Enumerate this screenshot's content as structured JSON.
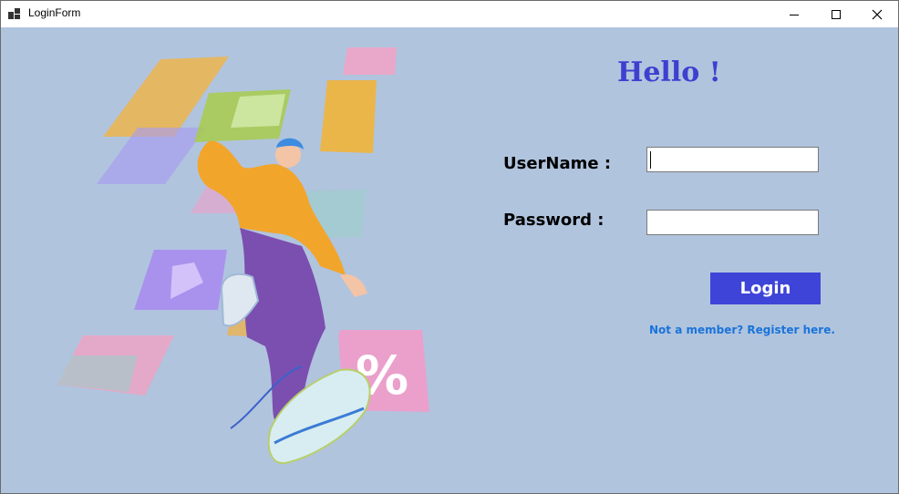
{
  "window": {
    "title": "LoginForm",
    "icon": "app-form-icon",
    "controls": [
      "minimize-icon",
      "maximize-icon",
      "close-icon"
    ]
  },
  "form": {
    "greeting": "Hello !",
    "username_label": "UserName :",
    "username_value": "",
    "password_label": "Password :",
    "password_value": "",
    "login_button": "Login",
    "register_link": "Not a member? Register here."
  },
  "illustration": {
    "icon": "shopping-person-illustration",
    "discount_glyph": "%"
  },
  "colors": {
    "background": "#b0c4de",
    "accent": "#3e44d7",
    "greeting": "#3f3fcf",
    "link": "#1a73d9"
  }
}
